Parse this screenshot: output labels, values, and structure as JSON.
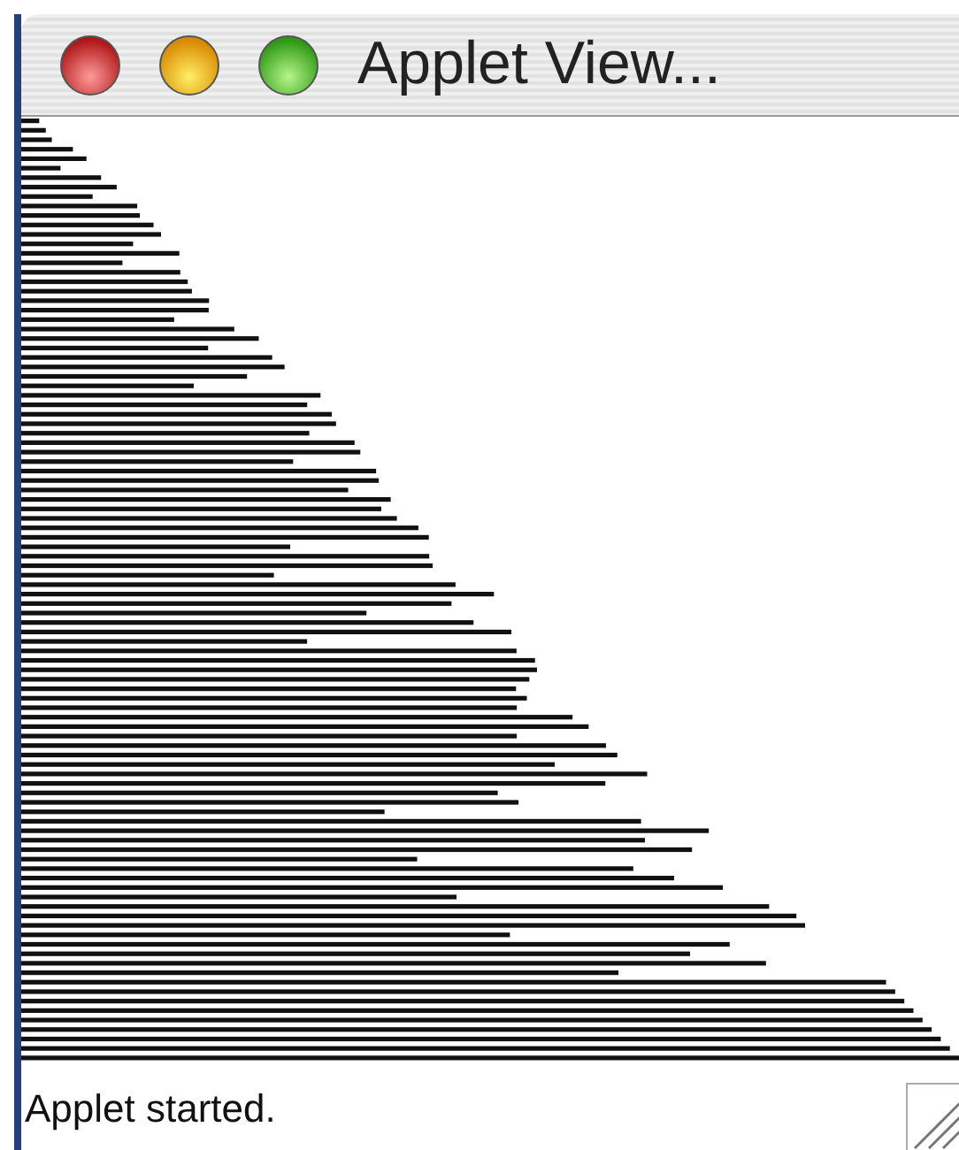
{
  "window": {
    "title": "Applet View..."
  },
  "status_bar": {
    "text": "Applet started."
  }
}
